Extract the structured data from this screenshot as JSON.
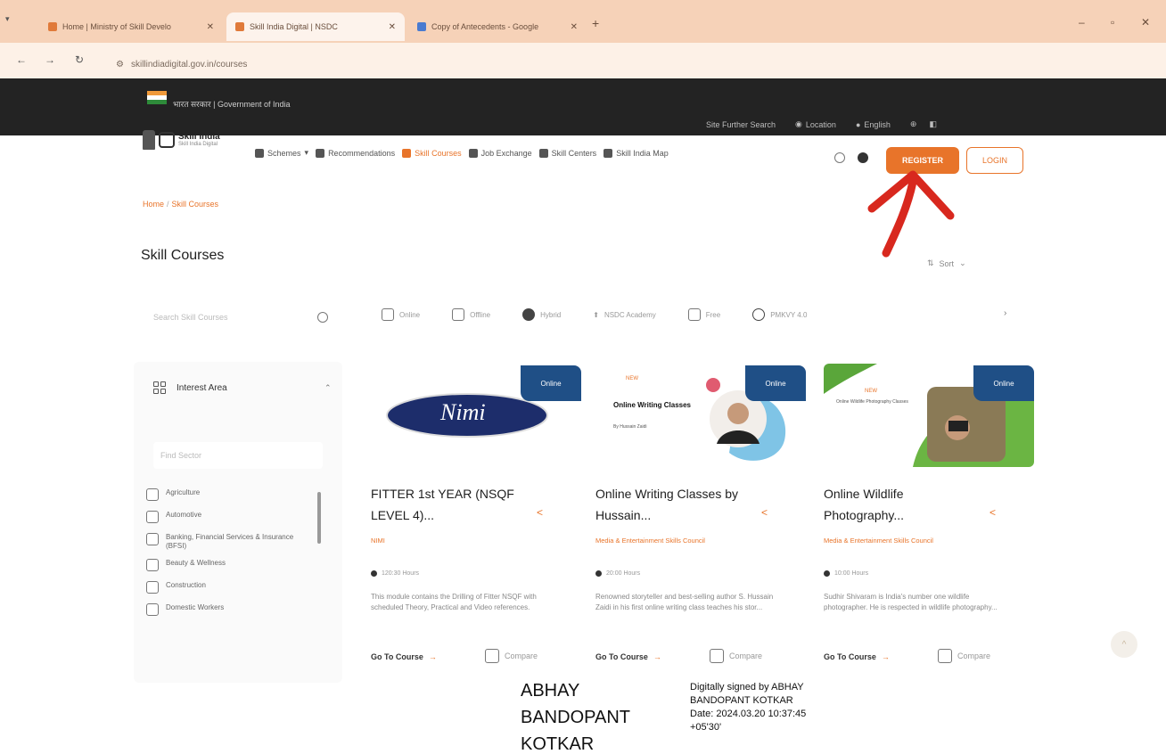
{
  "browser": {
    "tabs": [
      {
        "title": "Home | Ministry of Skill Develo",
        "active": false
      },
      {
        "title": "Skill India Digital | NSDC",
        "active": true
      },
      {
        "title": "Copy of Antecedents - Google",
        "active": false
      }
    ],
    "url": "skillindiadigital.gov.in/courses"
  },
  "gov_bar": {
    "text": "भारत सरकार | Government of India",
    "right_items": [
      "Site Further Search",
      "Location",
      "English"
    ]
  },
  "header": {
    "logo_text": "Skill India",
    "logo_sub": "Skill India Digital",
    "nav": [
      {
        "label": "Schemes",
        "active": false
      },
      {
        "label": "Recommendations",
        "active": false
      },
      {
        "label": "Skill Courses",
        "active": true
      },
      {
        "label": "Job Exchange",
        "active": false
      },
      {
        "label": "Skill Centers",
        "active": false
      },
      {
        "label": "Skill India Map",
        "active": false
      }
    ],
    "register_label": "Register",
    "login_label": "LOGIN"
  },
  "breadcrumb": {
    "home": "Home",
    "current": "Skill Courses"
  },
  "page": {
    "title": "Skill Courses",
    "sort_label": "Sort"
  },
  "search": {
    "placeholder": "Search Skill Courses"
  },
  "filters": {
    "heading": "Interest Area",
    "find_placeholder": "Find Sector",
    "items": [
      "Agriculture",
      "Automotive",
      "Banking, Financial Services & Insurance (BFSI)",
      "Beauty & Wellness",
      "Construction",
      "Domestic Workers"
    ]
  },
  "modes": [
    "Online",
    "Offline",
    "Hybrid",
    "NSDC Academy",
    "Free",
    "PMKVY 4.0"
  ],
  "courses": [
    {
      "badge": "Online",
      "image_text": "Nimi",
      "title": "FITTER 1st YEAR (NSQF LEVEL 4)...",
      "provider": "NIMI",
      "hours": "120:30 Hours",
      "description": "This module contains the Drilling of Fitter NSQF with scheduled Theory, Practical and Video references.",
      "go_label": "Go To Course",
      "compare_label": "Compare"
    },
    {
      "badge": "Online",
      "image_text": "Online Writing Classes",
      "image_sub": "By Hussain Zaidi",
      "image_tag": "NEW",
      "title": "Online Writing Classes by Hussain...",
      "provider": "Media & Entertainment Skills Council",
      "hours": "20:00 Hours",
      "description": "Renowned storyteller and best-selling author S. Hussain Zaidi in his first online writing class teaches his stor...",
      "go_label": "Go To Course",
      "compare_label": "Compare"
    },
    {
      "badge": "Online",
      "image_text": "Online Wildlife Photography Classes",
      "image_tag": "NEW",
      "title": "Online Wildlife Photography...",
      "provider": "Media & Entertainment Skills Council",
      "hours": "10:00 Hours",
      "description": "Sudhir Shivaram is India's number one wildlife photographer. He is respected in wildlife photography...",
      "go_label": "Go To Course",
      "compare_label": "Compare"
    }
  ],
  "signature": {
    "name_lines": [
      "ABHAY",
      "BANDOPANT",
      "KOTKAR"
    ],
    "text_lines": [
      "Digitally signed by ABHAY",
      "BANDOPANT KOTKAR",
      "Date: 2024.03.20 10:37:45",
      "+05'30'"
    ]
  },
  "colors": {
    "accent": "#e8742a",
    "badge": "#1f4f86",
    "annotation": "#d8281e"
  }
}
